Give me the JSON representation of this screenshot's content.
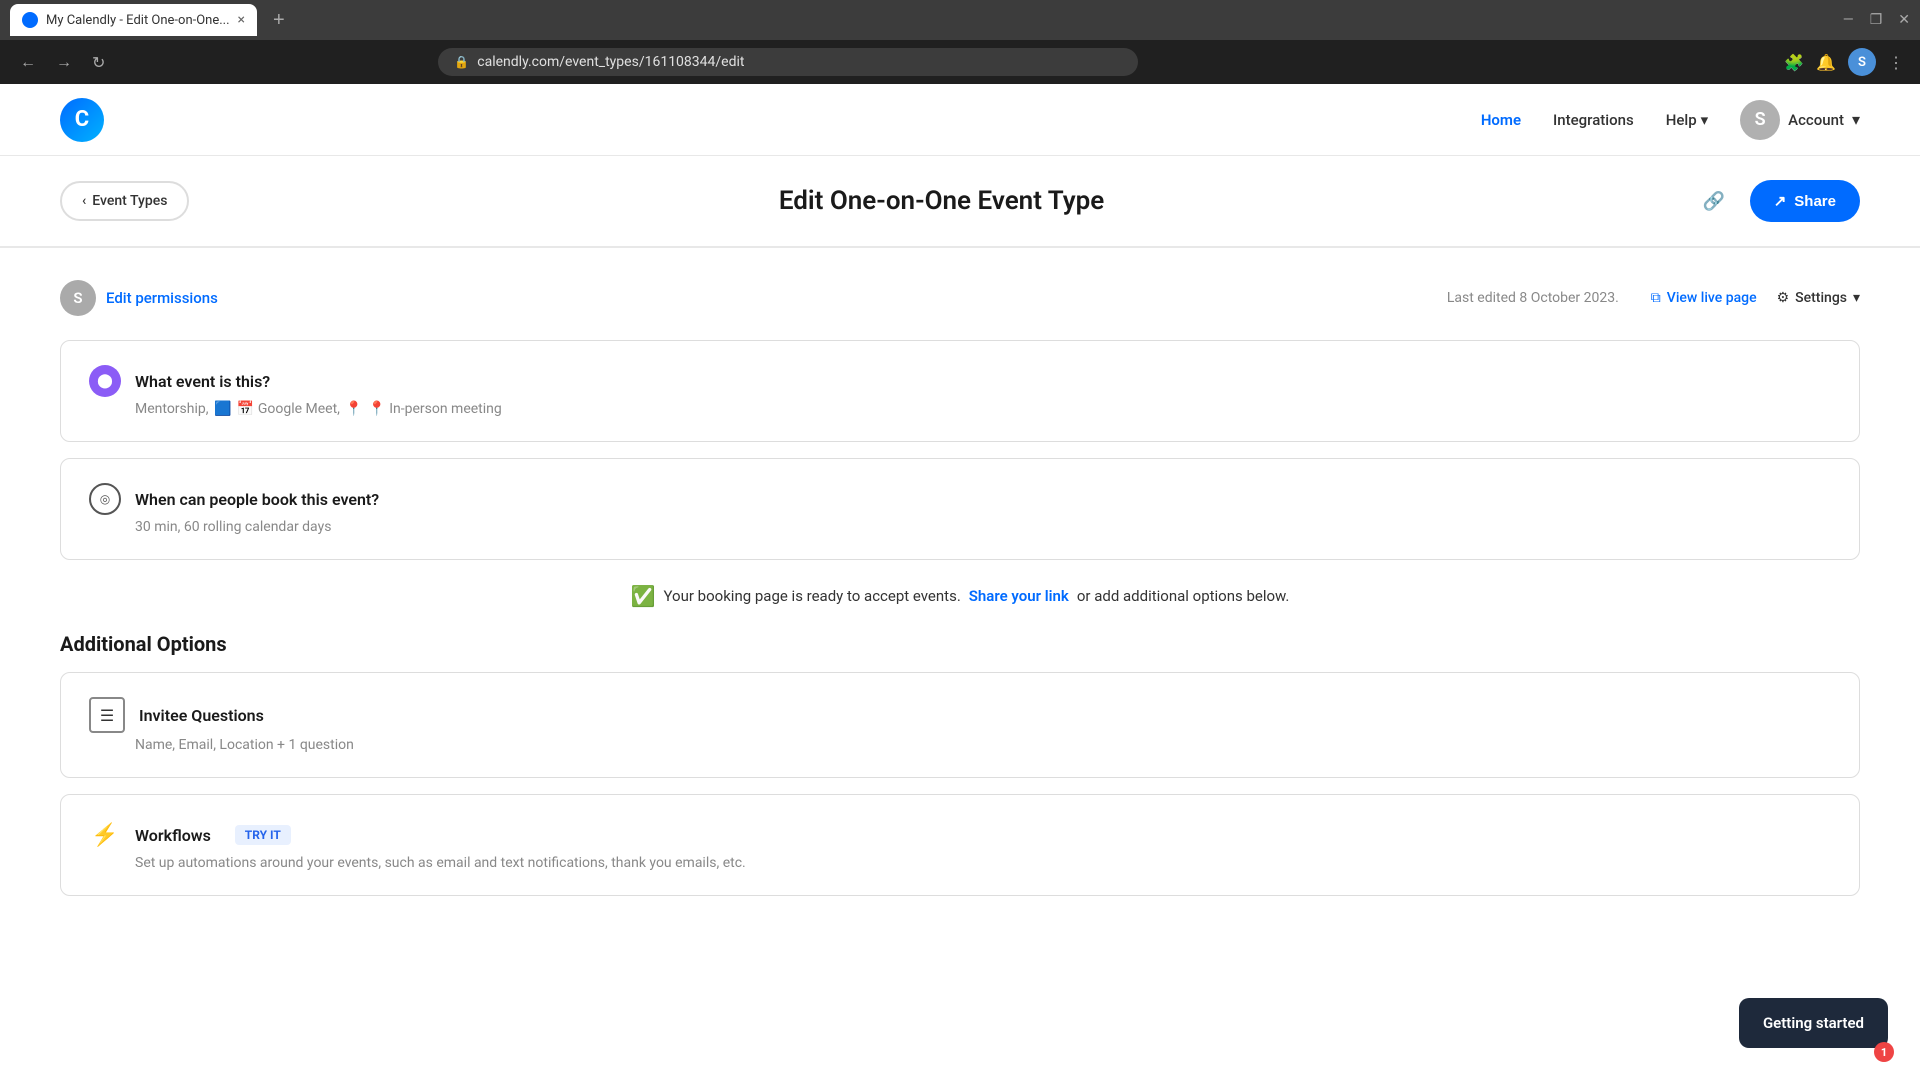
{
  "browser": {
    "tab_title": "My Calendly - Edit One-on-One...",
    "tab_close": "×",
    "new_tab": "+",
    "address": "calendly.com/event_types/161108344/edit",
    "window_minimize": "—",
    "window_maximize": "❐",
    "window_close": "✕",
    "profile_initial": "S"
  },
  "nav": {
    "home_label": "Home",
    "integrations_label": "Integrations",
    "help_label": "Help",
    "account_label": "Account",
    "avatar_initial": "S"
  },
  "header": {
    "back_label": "Event Types",
    "title": "Edit One-on-One Event Type",
    "share_label": "Share"
  },
  "permissions": {
    "avatar_initial": "S",
    "edit_permissions_label": "Edit permissions",
    "last_edited": "Last edited 8 October 2023.",
    "view_live_page_label": "View live page",
    "settings_label": "Settings"
  },
  "sections": {
    "what_event": {
      "title": "What event is this?",
      "subtitle_text": "Mentorship,",
      "google_meet": "📅 Google Meet,",
      "in_person": "📍 In-person meeting"
    },
    "when_book": {
      "title": "When can people book this event?",
      "subtitle": "30 min, 60 rolling calendar days"
    }
  },
  "ready_banner": {
    "text_before": "Your booking page is ready to accept events.",
    "link_text": "Share your link",
    "text_after": "or add additional options below."
  },
  "additional_options": {
    "title": "Additional Options",
    "invitee_questions": {
      "title": "Invitee Questions",
      "subtitle": "Name, Email, Location + 1 question"
    },
    "workflows": {
      "title": "Workflows",
      "badge": "TRY IT",
      "subtitle": "Set up automations around your events, such as email and text notifications, thank you emails, etc."
    }
  },
  "getting_started": {
    "label": "Getting started",
    "badge": "1"
  },
  "icons": {
    "back_chevron": "‹",
    "chevron_down": "▾",
    "link_icon": "🔗",
    "share_icon": "↗",
    "external_link": "⧉",
    "gear": "⚙",
    "check": "✓",
    "lightning": "⚡"
  }
}
